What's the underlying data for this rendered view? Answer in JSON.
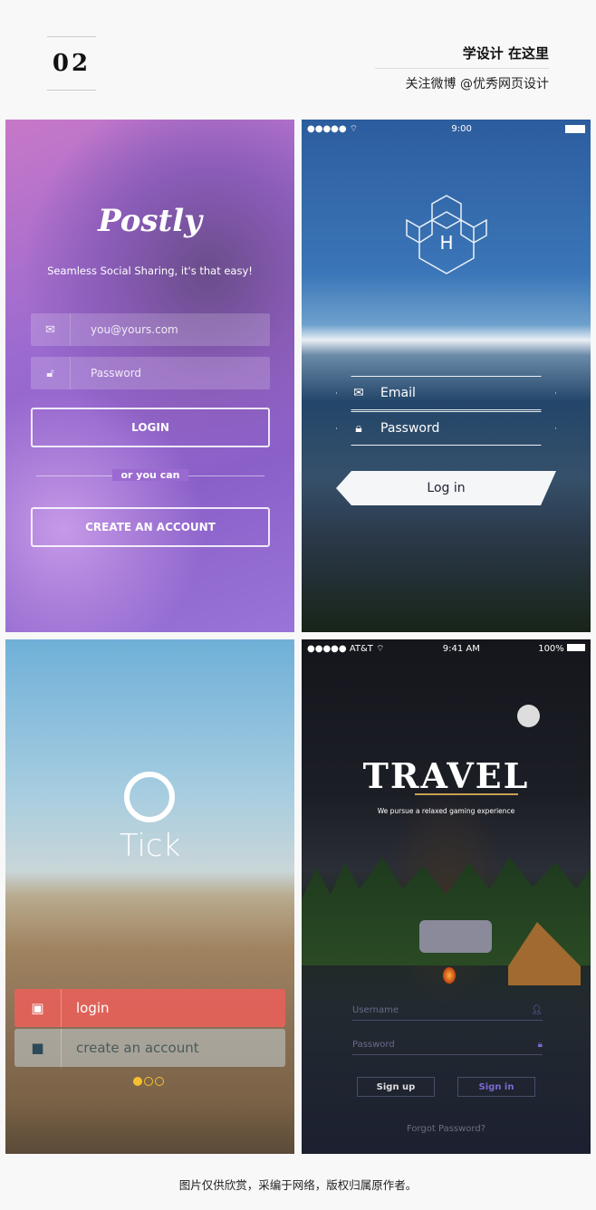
{
  "header": {
    "number": "02",
    "slogan": "学设计 在这里",
    "subtitle": "关注微博 @优秀网页设计"
  },
  "postly": {
    "logo": "Postly",
    "tagline": "Seamless Social Sharing, it's that easy!",
    "email_placeholder": "you@yours.com",
    "password_placeholder": "Password",
    "login": "LOGIN",
    "divider": "or you can",
    "create": "CREATE AN ACCOUNT",
    "icons": [
      "envelope-icon",
      "lock-icon"
    ]
  },
  "hex": {
    "time": "9:00",
    "logo_letter": "H",
    "email": "Email",
    "password": "Password",
    "login": "Log in"
  },
  "tick": {
    "logo": "Tick",
    "login": "login",
    "create": "create an account",
    "page_indicator": {
      "pages": 3,
      "active": 1
    },
    "colors": {
      "login": "#e8605a",
      "dot": "#f5c030"
    }
  },
  "travel": {
    "carrier": "AT&T",
    "time": "9:41 AM",
    "battery": "100%",
    "logo": "TRAVEL",
    "tagline": "We pursue a relaxed gaming experience",
    "username": "Username",
    "password": "Password",
    "signup": "Sign up",
    "signin": "Sign in",
    "forgot": "Forgot Password?",
    "accent": "#7a6ad0"
  },
  "footer": "图片仅供欣赏，采编于网络，版权归属原作者。"
}
